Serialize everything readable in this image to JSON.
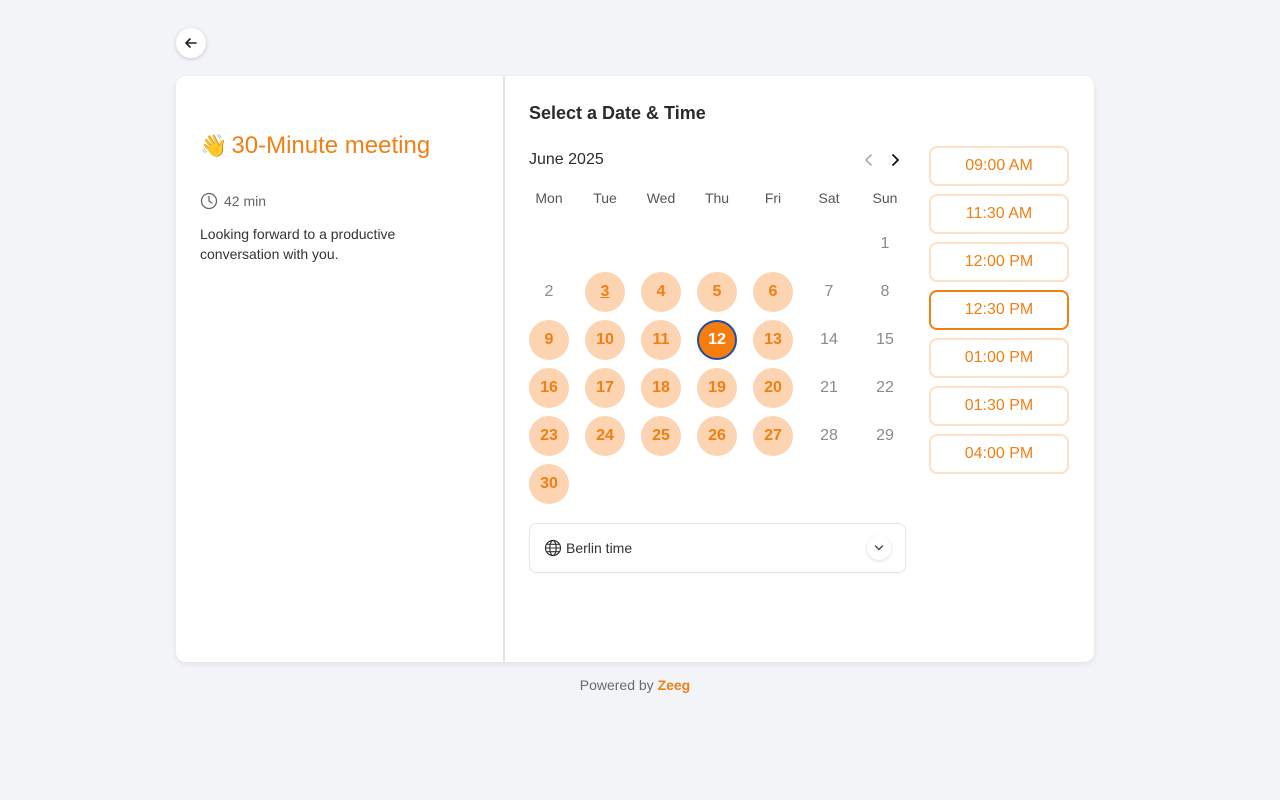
{
  "event": {
    "emoji": "👋",
    "title": "30-Minute meeting",
    "duration": "42 min",
    "description": "Looking forward to a productive conversation with you."
  },
  "scheduler": {
    "heading": "Select a Date & Time",
    "month": "June 2025",
    "weekdays": [
      "Mon",
      "Tue",
      "Wed",
      "Thu",
      "Fri",
      "Sat",
      "Sun"
    ],
    "days": [
      {
        "label": "",
        "state": "empty"
      },
      {
        "label": "",
        "state": "empty"
      },
      {
        "label": "",
        "state": "empty"
      },
      {
        "label": "",
        "state": "empty"
      },
      {
        "label": "",
        "state": "empty"
      },
      {
        "label": "",
        "state": "empty"
      },
      {
        "label": "1",
        "state": "unavailable"
      },
      {
        "label": "2",
        "state": "unavailable"
      },
      {
        "label": "3",
        "state": "today"
      },
      {
        "label": "4",
        "state": "available"
      },
      {
        "label": "5",
        "state": "available"
      },
      {
        "label": "6",
        "state": "available"
      },
      {
        "label": "7",
        "state": "unavailable"
      },
      {
        "label": "8",
        "state": "unavailable"
      },
      {
        "label": "9",
        "state": "available"
      },
      {
        "label": "10",
        "state": "available"
      },
      {
        "label": "11",
        "state": "available"
      },
      {
        "label": "12",
        "state": "selected"
      },
      {
        "label": "13",
        "state": "available"
      },
      {
        "label": "14",
        "state": "unavailable"
      },
      {
        "label": "15",
        "state": "unavailable"
      },
      {
        "label": "16",
        "state": "available"
      },
      {
        "label": "17",
        "state": "available"
      },
      {
        "label": "18",
        "state": "available"
      },
      {
        "label": "19",
        "state": "available"
      },
      {
        "label": "20",
        "state": "available"
      },
      {
        "label": "21",
        "state": "unavailable"
      },
      {
        "label": "22",
        "state": "unavailable"
      },
      {
        "label": "23",
        "state": "available"
      },
      {
        "label": "24",
        "state": "available"
      },
      {
        "label": "25",
        "state": "available"
      },
      {
        "label": "26",
        "state": "available"
      },
      {
        "label": "27",
        "state": "available"
      },
      {
        "label": "28",
        "state": "unavailable"
      },
      {
        "label": "29",
        "state": "unavailable"
      },
      {
        "label": "30",
        "state": "available"
      }
    ],
    "timezone": "Berlin time",
    "slots": [
      {
        "label": "09:00 AM",
        "active": false
      },
      {
        "label": "11:30 AM",
        "active": false
      },
      {
        "label": "12:00 PM",
        "active": false
      },
      {
        "label": "12:30 PM",
        "active": true
      },
      {
        "label": "01:00 PM",
        "active": false
      },
      {
        "label": "01:30 PM",
        "active": false
      },
      {
        "label": "04:00 PM",
        "active": false
      }
    ]
  },
  "footer": {
    "prefix": "Powered by ",
    "brand": "Zeeg"
  },
  "icons": {
    "back": "arrow-left-icon",
    "clock": "clock-icon",
    "prev": "chevron-left-icon",
    "next": "chevron-right-icon",
    "globe": "globe-icon",
    "dropdown": "chevron-down-icon"
  },
  "colors": {
    "accent": "#f07f14",
    "available_bg": "#fdd4b1",
    "selected_bg": "#f57c0d",
    "selected_ring": "#1f4fa3",
    "page_bg": "#f2f4f8"
  }
}
